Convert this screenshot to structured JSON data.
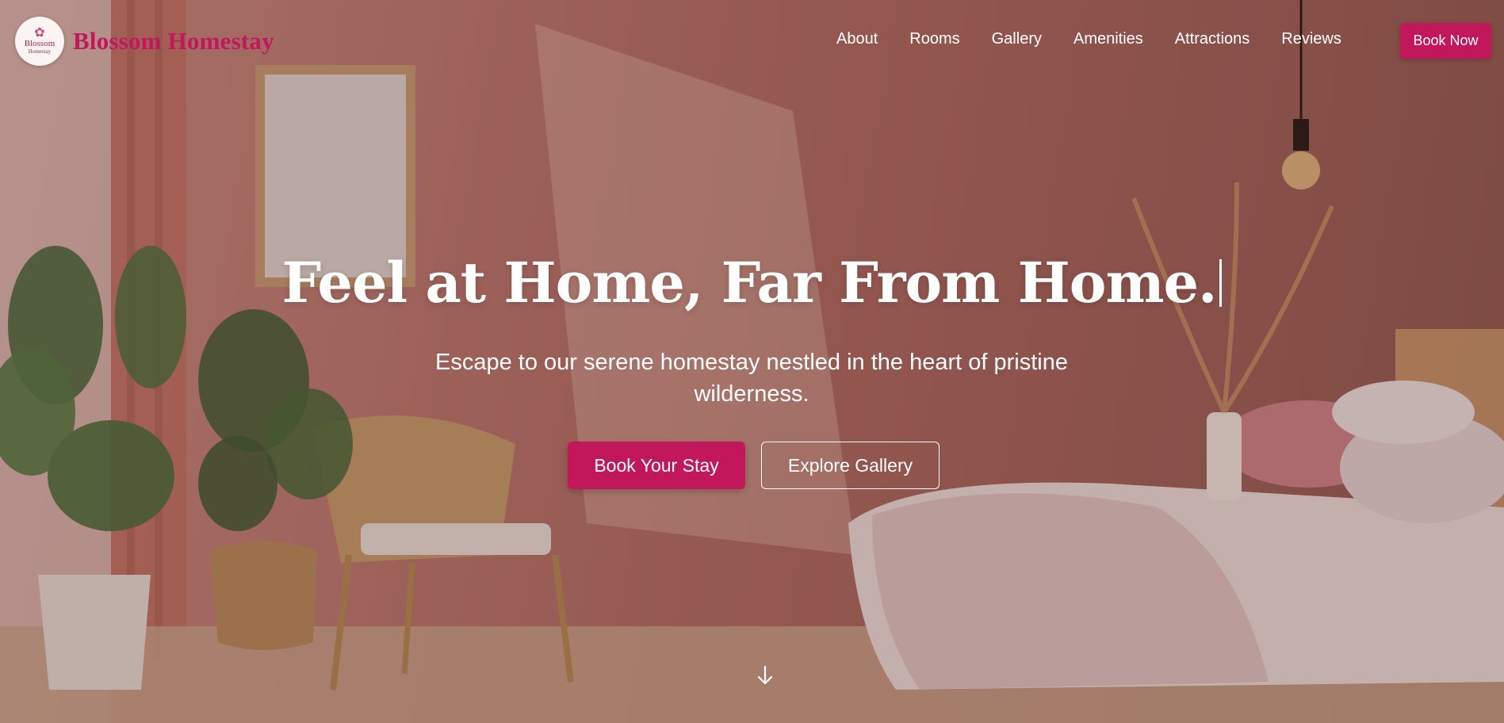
{
  "navbar": {
    "brand": {
      "logo_line1": "Blossom",
      "logo_line2": "Homestay",
      "logo_icon": "flower-house-icon",
      "name": "Blossom Homestay"
    },
    "links": [
      {
        "label": "About"
      },
      {
        "label": "Rooms"
      },
      {
        "label": "Gallery"
      },
      {
        "label": "Amenities"
      },
      {
        "label": "Attractions"
      },
      {
        "label": "Reviews"
      }
    ],
    "cta_label": "Book Now"
  },
  "hero": {
    "title": "Feel at Home, Far From Home.",
    "subtitle": "Escape to our serene homestay nestled in the heart of pristine wilderness.",
    "primary_cta": "Book Your Stay",
    "secondary_cta": "Explore Gallery",
    "scroll_icon": "arrow-down-icon"
  },
  "colors": {
    "brand": "#c2185b",
    "text_light": "#ffffff",
    "logo_bg": "#fbf4f2"
  }
}
